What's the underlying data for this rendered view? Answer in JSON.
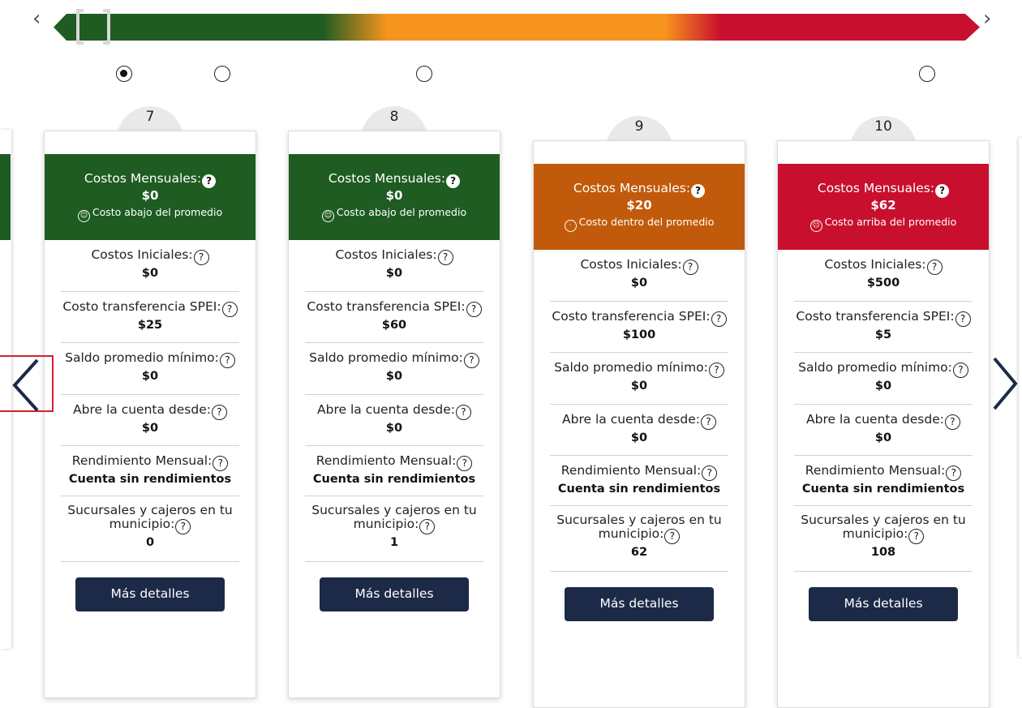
{
  "range": {
    "prev_glyph": "‹",
    "next_glyph": "›",
    "gradient_colors": [
      "#1e5c22",
      "#f7941d",
      "#c8102e"
    ],
    "radios": [
      {
        "checked": true
      },
      {
        "checked": false
      },
      {
        "checked": false
      },
      {
        "checked": false
      }
    ]
  },
  "carousel": {
    "prev_icon": "chevron-left-icon",
    "next_icon": "chevron-right-icon"
  },
  "labels": {
    "monthly_costs": "Costos Mensuales:",
    "initial_costs": "Costos Iniciales:",
    "spei_cost": "Costo transferencia SPEI:",
    "min_balance": "Saldo promedio mínimo:",
    "open_from": "Abre la cuenta desde:",
    "monthly_return": "Rendimiento Mensual:",
    "branches": "Sucursales y cajeros en tu municipio:",
    "details_button": "Más detalles",
    "help_glyph": "?"
  },
  "cards": [
    {
      "number": "7",
      "head_color": "#1e5c22",
      "monthly_cost": "$0",
      "status_icon": "smile-icon",
      "status_glyph": "☺",
      "status_text": "Costo abajo del promedio",
      "initial_costs": "$0",
      "spei_cost": "$25",
      "min_balance": "$0",
      "open_from": "$0",
      "monthly_return": "Cuenta sin rendimientos",
      "branches": "0"
    },
    {
      "number": "8",
      "head_color": "#1e5c22",
      "monthly_cost": "$0",
      "status_icon": "smile-icon",
      "status_glyph": "☺",
      "status_text": "Costo abajo del promedio",
      "initial_costs": "$0",
      "spei_cost": "$60",
      "min_balance": "$0",
      "open_from": "$0",
      "monthly_return": "Cuenta sin rendimientos",
      "branches": "1"
    },
    {
      "number": "9",
      "head_color": "#c15b0b",
      "monthly_cost": "$20",
      "status_icon": "neutral-face-icon",
      "status_glyph": "·",
      "status_text": "Costo dentro del promedio",
      "initial_costs": "$0",
      "spei_cost": "$100",
      "min_balance": "$0",
      "open_from": "$0",
      "monthly_return": "Cuenta sin rendimientos",
      "branches": "62"
    },
    {
      "number": "10",
      "head_color": "#c8102e",
      "monthly_cost": "$62",
      "status_icon": "frown-icon",
      "status_glyph": "☹",
      "status_text": "Costo arriba del promedio",
      "initial_costs": "$500",
      "spei_cost": "$5",
      "min_balance": "$0",
      "open_from": "$0",
      "monthly_return": "Cuenta sin rendimientos",
      "branches": "108"
    }
  ]
}
